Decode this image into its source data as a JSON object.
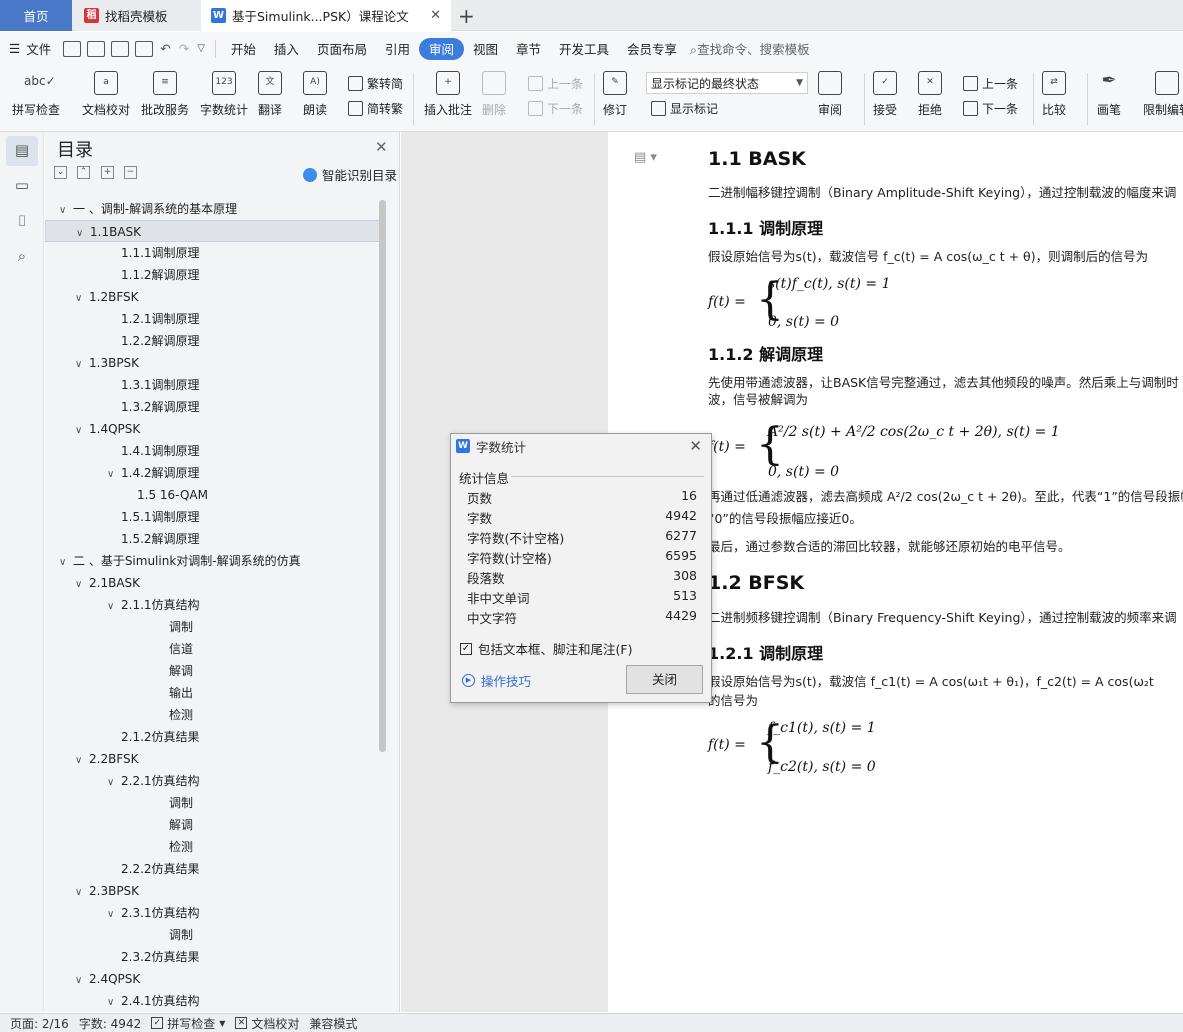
{
  "tabs": [
    {
      "label": "首页"
    },
    {
      "label": "找稻壳模板"
    },
    {
      "label": "基于Simulink...PSK）课程论文"
    }
  ],
  "menu": {
    "file": "文件",
    "items": [
      "开始",
      "插入",
      "页面布局",
      "引用",
      "审阅",
      "视图",
      "章节",
      "开发工具",
      "会员专享"
    ],
    "active": "审阅",
    "search": "查找命令、搜索模板"
  },
  "ribbon": {
    "spell": "拼写检查",
    "doc_check": "文档校对",
    "batch": "批改服务",
    "word_count": "字数统计",
    "translate": "翻译",
    "read": "朗读",
    "trad": "繁转简",
    "simp": "简转繁",
    "insert_comment": "插入批注",
    "delete": "删除",
    "prev": "上一条",
    "next": "下一条",
    "revise": "修订",
    "markup_select": "显示标记的最终状态",
    "show_markup": "显示标记",
    "review": "审阅",
    "accept": "接受",
    "reject": "拒绝",
    "prev2": "上一条",
    "next2": "下一条",
    "compare": "比较",
    "pen": "画笔",
    "restrict": "限制编辑"
  },
  "toc": {
    "title": "目录",
    "smart": "智能识别目录",
    "items": [
      {
        "label": "一 、调制-解调系统的基本原理",
        "level": 1,
        "arrow": "∨"
      },
      {
        "label": "1.1BASK",
        "level": 2,
        "arrow": "∨",
        "selected": true
      },
      {
        "label": "1.1.1调制原理",
        "level": 3,
        "arrow": ""
      },
      {
        "label": "1.1.2解调原理",
        "level": 3,
        "arrow": ""
      },
      {
        "label": "1.2BFSK",
        "level": 2,
        "arrow": "∨"
      },
      {
        "label": "1.2.1调制原理",
        "level": 3,
        "arrow": ""
      },
      {
        "label": "1.2.2解调原理",
        "level": 3,
        "arrow": ""
      },
      {
        "label": "1.3BPSK",
        "level": 2,
        "arrow": "∨"
      },
      {
        "label": "1.3.1调制原理",
        "level": 3,
        "arrow": ""
      },
      {
        "label": "1.3.2解调原理",
        "level": 3,
        "arrow": ""
      },
      {
        "label": "1.4QPSK",
        "level": 2,
        "arrow": "∨"
      },
      {
        "label": "1.4.1调制原理",
        "level": 3,
        "arrow": ""
      },
      {
        "label": "1.4.2解调原理",
        "level": 3,
        "arrow": "∨"
      },
      {
        "label": "1.5 16-QAM",
        "level": 4,
        "arrow": ""
      },
      {
        "label": "1.5.1调制原理",
        "level": 3,
        "arrow": ""
      },
      {
        "label": "1.5.2解调原理",
        "level": 3,
        "arrow": ""
      },
      {
        "label": "二 、基于Simulink对调制-解调系统的仿真",
        "level": 1,
        "arrow": "∨"
      },
      {
        "label": "2.1BASK",
        "level": 2,
        "arrow": "∨"
      },
      {
        "label": "2.1.1仿真结构",
        "level": 3,
        "arrow": "∨"
      },
      {
        "label": "调制",
        "level": 5,
        "arrow": ""
      },
      {
        "label": "信道",
        "level": 5,
        "arrow": ""
      },
      {
        "label": "解调",
        "level": 5,
        "arrow": ""
      },
      {
        "label": "输出",
        "level": 5,
        "arrow": ""
      },
      {
        "label": "检测",
        "level": 5,
        "arrow": ""
      },
      {
        "label": "2.1.2仿真结果",
        "level": 3,
        "arrow": ""
      },
      {
        "label": "2.2BFSK",
        "level": 2,
        "arrow": "∨"
      },
      {
        "label": "2.2.1仿真结构",
        "level": 3,
        "arrow": "∨"
      },
      {
        "label": "调制",
        "level": 5,
        "arrow": ""
      },
      {
        "label": "解调",
        "level": 5,
        "arrow": ""
      },
      {
        "label": "检测",
        "level": 5,
        "arrow": ""
      },
      {
        "label": "2.2.2仿真结果",
        "level": 3,
        "arrow": ""
      },
      {
        "label": "2.3BPSK",
        "level": 2,
        "arrow": "∨"
      },
      {
        "label": "2.3.1仿真结构",
        "level": 3,
        "arrow": "∨"
      },
      {
        "label": "调制",
        "level": 5,
        "arrow": ""
      },
      {
        "label": "2.3.2仿真结果",
        "level": 3,
        "arrow": ""
      },
      {
        "label": "2.4QPSK",
        "level": 2,
        "arrow": "∨"
      },
      {
        "label": "2.4.1仿真结构",
        "level": 3,
        "arrow": "∨"
      }
    ]
  },
  "doc": {
    "h_11": "1.1 BASK",
    "p_11": "二进制幅移键控调制（Binary Amplitude-Shift Keying），通过控制载波的幅度来调",
    "h_111": "1.1.1 调制原理",
    "p_111": "假设原始信号为s(t)，载波信号 f_c(t) = A cos(ω_c t + θ)，则调制后的信号为",
    "eq1_lhs": "f(t) =",
    "eq1_a": "s(t)f_c(t), s(t) = 1",
    "eq1_b": "0, s(t) = 0",
    "h_112": "1.1.2 解调原理",
    "p_112a": "先使用带通滤波器，让BASK信号完整通过，滤去其他频段的噪声。然后乘上与调制时",
    "p_112b": "波，信号被解调为",
    "eq2_lhs": "f(t) =",
    "eq2_a": "A²/2 s(t) + A²/2 cos(2ω_c t + 2θ), s(t) = 1",
    "eq2_b": "0, s(t) = 0",
    "p_112c": "再通过低通滤波器，滤去高频成 A²/2 cos(2ω_c t + 2θ)。至此，代表“1”的信号段振幅成",
    "p_112d": "“0”的信号段振幅应接近0。",
    "p_112e": "最后，通过参数合适的滞回比较器，就能够还原初始的电平信号。",
    "h_12": "1.2 BFSK",
    "p_12": "二进制频移键控调制（Binary Frequency-Shift Keying），通过控制载波的频率来调",
    "h_121": "1.2.1 调制原理",
    "p_121a": "假设原始信号为s(t)，载波信 f_c1(t) = A cos(ω₁t + θ₁)，f_c2(t) = A cos(ω₂t",
    "p_121b": "的信号为",
    "eq3_lhs": "f(t) =",
    "eq3_a": "f_c1(t), s(t) = 1",
    "eq3_b": "f_c2(t), s(t) = 0"
  },
  "dialog": {
    "title": "字数统计",
    "section": "统计信息",
    "stats": [
      {
        "label": "页数",
        "value": "16"
      },
      {
        "label": "字数",
        "value": "4942"
      },
      {
        "label": "字符数(不计空格)",
        "value": "6277"
      },
      {
        "label": "字符数(计空格)",
        "value": "6595"
      },
      {
        "label": "段落数",
        "value": "308"
      },
      {
        "label": "非中文单词",
        "value": "513"
      },
      {
        "label": "中文字符",
        "value": "4429"
      }
    ],
    "checkbox": "包括文本框、脚注和尾注(F)",
    "tips": "操作技巧",
    "close": "关闭"
  },
  "status": {
    "page": "页面: 2/16",
    "words": "字数: 4942",
    "spell": "拼写检查",
    "check": "文档校对",
    "compat": "兼容模式"
  }
}
